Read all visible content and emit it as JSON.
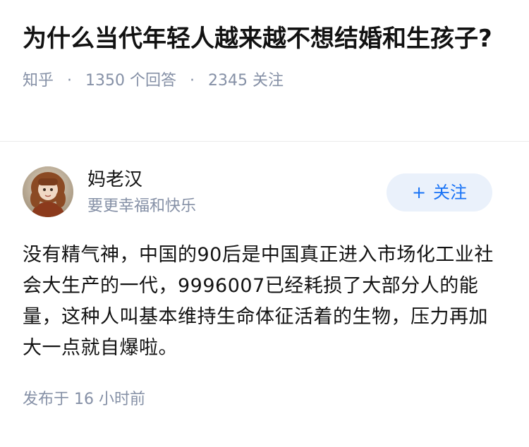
{
  "question": {
    "title": "为什么当代年轻人越来越不想结婚和生孩子?",
    "source": "知乎",
    "answers_count": "1350",
    "answers_label": "个回答",
    "followers_count": "2345",
    "followers_label": "关注"
  },
  "answer": {
    "author": {
      "name": "妈老汉",
      "bio": "要更幸福和快乐"
    },
    "follow_button": {
      "plus": "+",
      "label": "关注"
    },
    "body": "没有精气神，中国的90后是中国真正进入市场化工业社会大生产的一代，9996007已经耗损了大部分人的能量，这种人叫基本维持生命体征活着的生物，压力再加大一点就自爆啦。",
    "posted_label": "发布于",
    "posted_time": "16 小时前"
  },
  "colors": {
    "title": "#121212",
    "meta": "#8590a6",
    "accent": "#1772f6",
    "follow_bg": "#eaf1fb",
    "divider": "#ebebeb"
  }
}
